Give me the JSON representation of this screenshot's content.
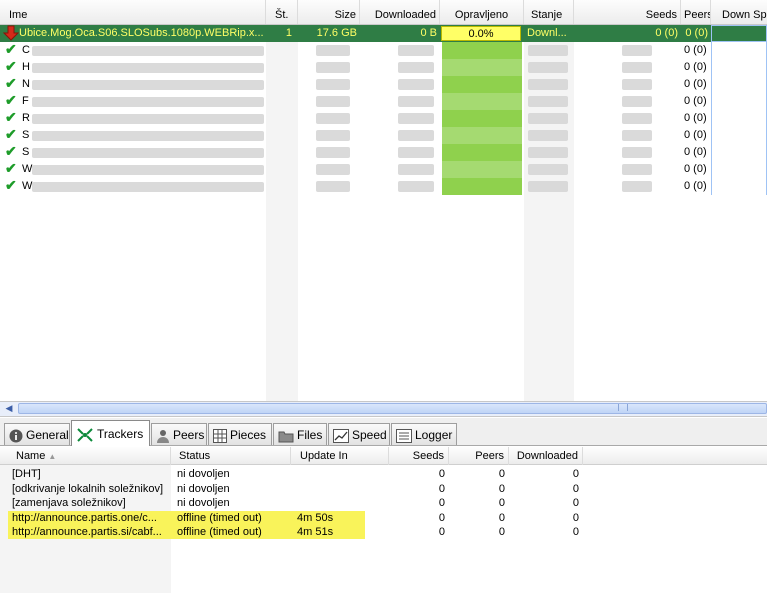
{
  "torrent_list": {
    "columns": [
      "Ime",
      "Št.",
      "Size",
      "Downloaded",
      "Opravljeno",
      "Stanje",
      "Seeds",
      "Peers",
      "Down Speed"
    ],
    "selected": {
      "name": "Ubice.Mog.Oca.S06.SLOSubs.1080p.WEBRip.x...",
      "number": "1",
      "size": "17.6 GB",
      "downloaded": "0 B",
      "progress": "0.0%",
      "progress_value": 0.0,
      "status": "Downl...",
      "seeds": "0 (0)",
      "peers": "0 (0)"
    },
    "completed_rows": [
      {
        "initial": "C",
        "peers": "0 (0)"
      },
      {
        "initial": "H",
        "peers": "0 (0)"
      },
      {
        "initial": "N",
        "peers": "0 (0)"
      },
      {
        "initial": "F",
        "peers": "0 (0)"
      },
      {
        "initial": "R",
        "peers": "0 (0)"
      },
      {
        "initial": "S",
        "peers": "0 (0)"
      },
      {
        "initial": "S",
        "peers": "0 (0)"
      },
      {
        "initial": "W",
        "peers": "0 (0)"
      },
      {
        "initial": "W",
        "peers": "0 (0)"
      }
    ]
  },
  "tabs": [
    {
      "label": "General",
      "icon": "info-icon"
    },
    {
      "label": "Trackers",
      "icon": "trackers-icon",
      "active": true
    },
    {
      "label": "Peers",
      "icon": "peers-icon"
    },
    {
      "label": "Pieces",
      "icon": "pieces-icon"
    },
    {
      "label": "Files",
      "icon": "folder-icon"
    },
    {
      "label": "Speed",
      "icon": "speed-graph-icon"
    },
    {
      "label": "Logger",
      "icon": "logger-icon"
    }
  ],
  "trackers": {
    "columns": [
      "Name",
      "Status",
      "Update In",
      "Seeds",
      "Peers",
      "Downloaded"
    ],
    "rows": [
      {
        "name": "[DHT]",
        "status": "ni dovoljen",
        "update": "",
        "seeds": "0",
        "peers": "0",
        "downloaded": "0",
        "highlight": false
      },
      {
        "name": "[odkrivanje lokalnih soležnikov]",
        "status": "ni dovoljen",
        "update": "",
        "seeds": "0",
        "peers": "0",
        "downloaded": "0",
        "highlight": false
      },
      {
        "name": "[zamenjava soležnikov]",
        "status": "ni dovoljen",
        "update": "",
        "seeds": "0",
        "peers": "0",
        "downloaded": "0",
        "highlight": false
      },
      {
        "name": "http://announce.partis.one/c...",
        "status": "offline (timed out)",
        "update": "4m 50s",
        "seeds": "0",
        "peers": "0",
        "downloaded": "0",
        "highlight": true
      },
      {
        "name": "http://announce.partis.si/cabf...",
        "status": "offline (timed out)",
        "update": "4m 51s",
        "seeds": "0",
        "peers": "0",
        "downloaded": "0",
        "highlight": true
      }
    ]
  },
  "colors": {
    "selected_row": "#2f7d45",
    "selected_text": "#ffff66",
    "highlight": "#f9f35a",
    "progress_green": "#8fd14d"
  }
}
